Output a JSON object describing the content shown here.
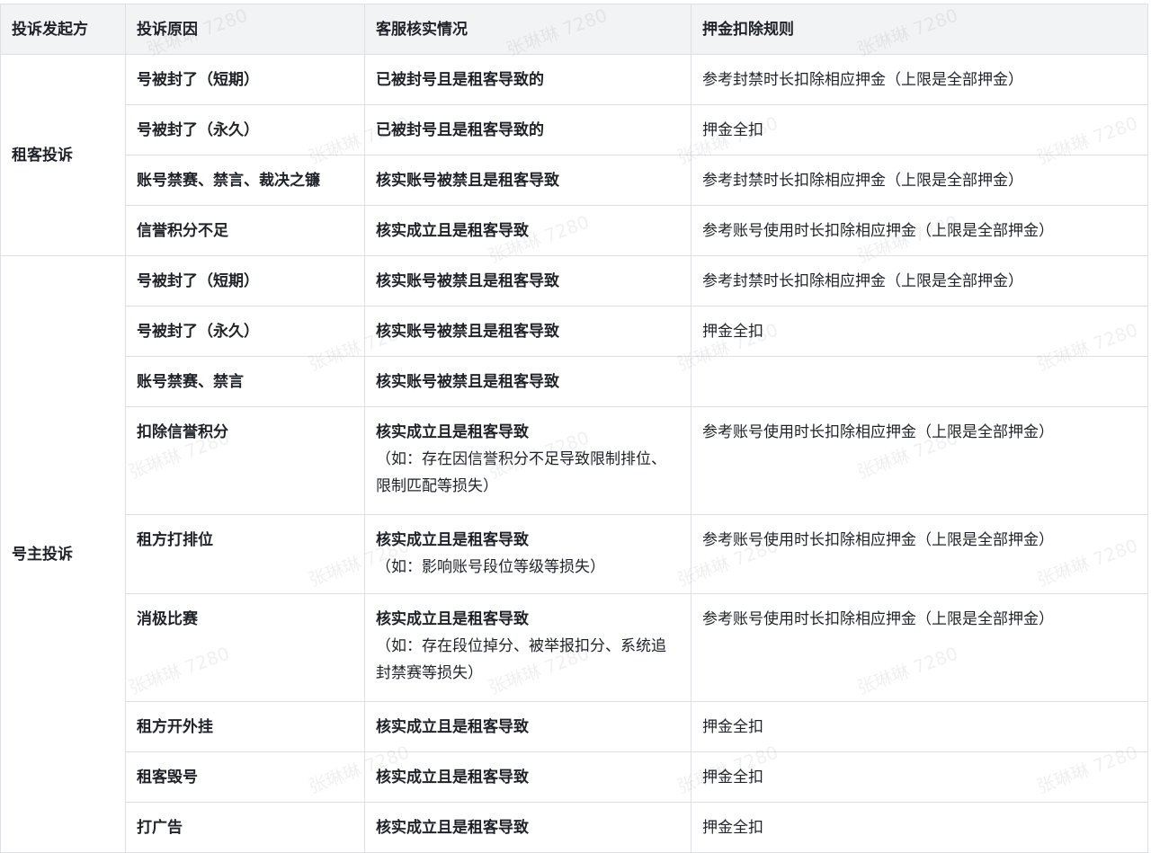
{
  "headers": [
    "投诉发起方",
    "投诉原因",
    "客服核实情况",
    "押金扣除规则"
  ],
  "groups": [
    {
      "party": "租客投诉",
      "rows": [
        {
          "reason": "号被封了（短期）",
          "verify": "已被封号且是租客导致的",
          "note": "",
          "rule": "参考封禁时长扣除相应押金（上限是全部押金）"
        },
        {
          "reason": "号被封了（永久）",
          "verify": "已被封号且是租客导致的",
          "note": "",
          "rule": "押金全扣"
        },
        {
          "reason": "账号禁赛、禁言、裁决之镰",
          "verify": "核实账号被禁且是租客导致",
          "note": "",
          "rule": "参考封禁时长扣除相应押金（上限是全部押金）"
        },
        {
          "reason": "信誉积分不足",
          "verify": "核实成立且是租客导致",
          "note": "",
          "rule": "参考账号使用时长扣除相应押金（上限是全部押金）"
        }
      ]
    },
    {
      "party": "号主投诉",
      "rows": [
        {
          "reason": "号被封了（短期）",
          "verify": "核实账号被禁且是租客导致",
          "note": "",
          "rule": "参考封禁时长扣除相应押金（上限是全部押金）"
        },
        {
          "reason": "号被封了（永久）",
          "verify": "核实账号被禁且是租客导致",
          "note": "",
          "rule": "押金全扣"
        },
        {
          "reason": "账号禁赛、禁言",
          "verify": "核实账号被禁且是租客导致",
          "note": "",
          "rule": ""
        },
        {
          "reason": "扣除信誉积分",
          "verify": "核实成立且是租客导致",
          "note": "（如：存在因信誉积分不足导致限制排位、限制匹配等损失）",
          "rule": "参考账号使用时长扣除相应押金（上限是全部押金）"
        },
        {
          "reason": "租方打排位",
          "verify": "核实成立且是租客导致",
          "note": "（如：影响账号段位等级等损失）",
          "rule": "参考账号使用时长扣除相应押金（上限是全部押金）"
        },
        {
          "reason": "消极比赛",
          "verify": "核实成立且是租客导致",
          "note": "（如：存在段位掉分、被举报扣分、系统追封禁赛等损失）",
          "rule": "参考账号使用时长扣除相应押金（上限是全部押金）"
        },
        {
          "reason": "租方开外挂",
          "verify": "核实成立且是租客导致",
          "note": "",
          "rule": "押金全扣"
        },
        {
          "reason": "租客毁号",
          "verify": "核实成立且是租客导致",
          "note": "",
          "rule": "押金全扣"
        },
        {
          "reason": "打广告",
          "verify": "核实成立且是租客导致",
          "note": "",
          "rule": "押金全扣"
        }
      ]
    }
  ],
  "watermark": "张琳琳 7280"
}
